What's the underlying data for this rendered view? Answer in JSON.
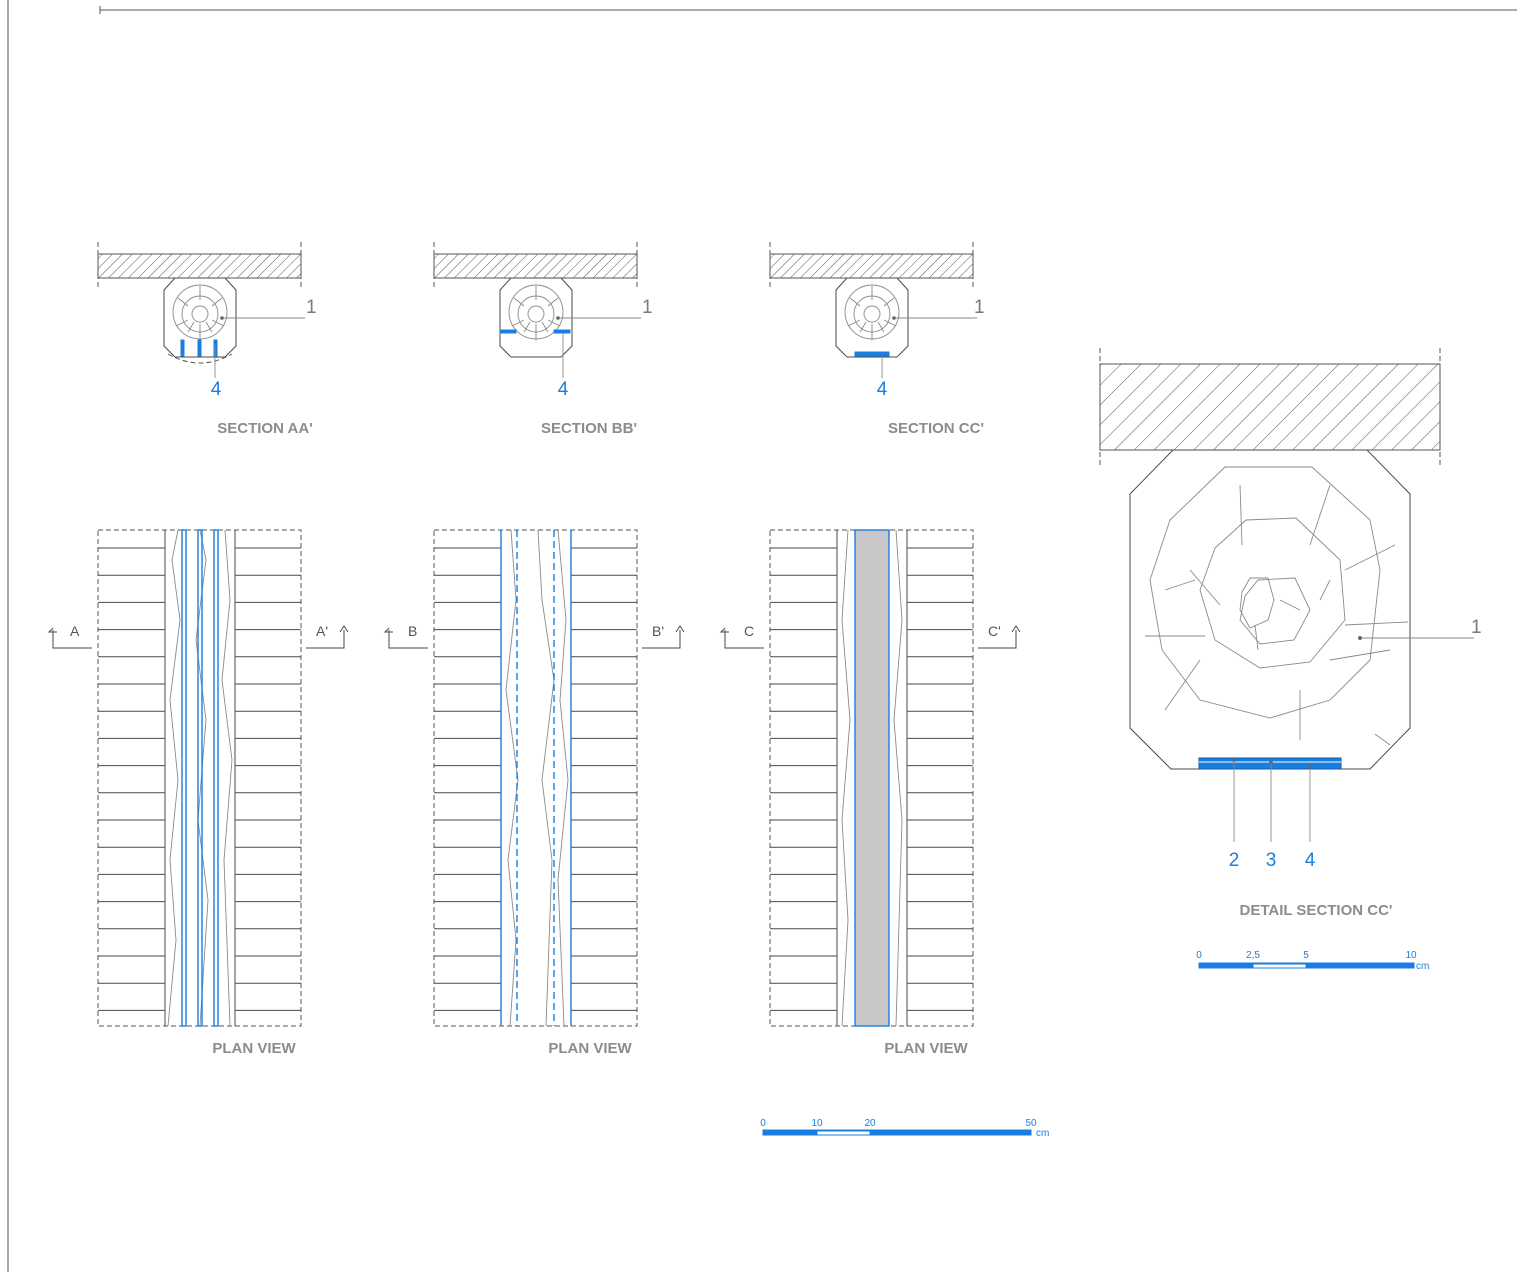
{
  "sections": [
    {
      "title": "SECTION AA'",
      "leader_left": "1",
      "leader_bottom": "4"
    },
    {
      "title": "SECTION BB'",
      "leader_left": "1",
      "leader_bottom": "4"
    },
    {
      "title": "SECTION CC'",
      "leader_left": "1",
      "leader_bottom": "4"
    }
  ],
  "plans": [
    {
      "title": "PLAN VIEW",
      "cut_left": "A",
      "cut_right": "A'"
    },
    {
      "title": "PLAN VIEW",
      "cut_left": "B",
      "cut_right": "B'"
    },
    {
      "title": "PLAN VIEW",
      "cut_left": "C",
      "cut_right": "C'"
    }
  ],
  "detail": {
    "title": "DETAIL SECTION CC'",
    "leader_1": "1",
    "callouts": [
      "2",
      "3",
      "4"
    ]
  },
  "scale_plan": {
    "ticks": [
      "0",
      "10",
      "20",
      "50"
    ],
    "unit": "cm"
  },
  "scale_detail": {
    "ticks": [
      "0",
      "2,5",
      "5",
      "10"
    ],
    "unit": "cm"
  },
  "colors": {
    "accent": "#1a7ee0",
    "line": "#4a4a4a",
    "label": "#8c8c8c",
    "fill": "#c8c8c8"
  }
}
